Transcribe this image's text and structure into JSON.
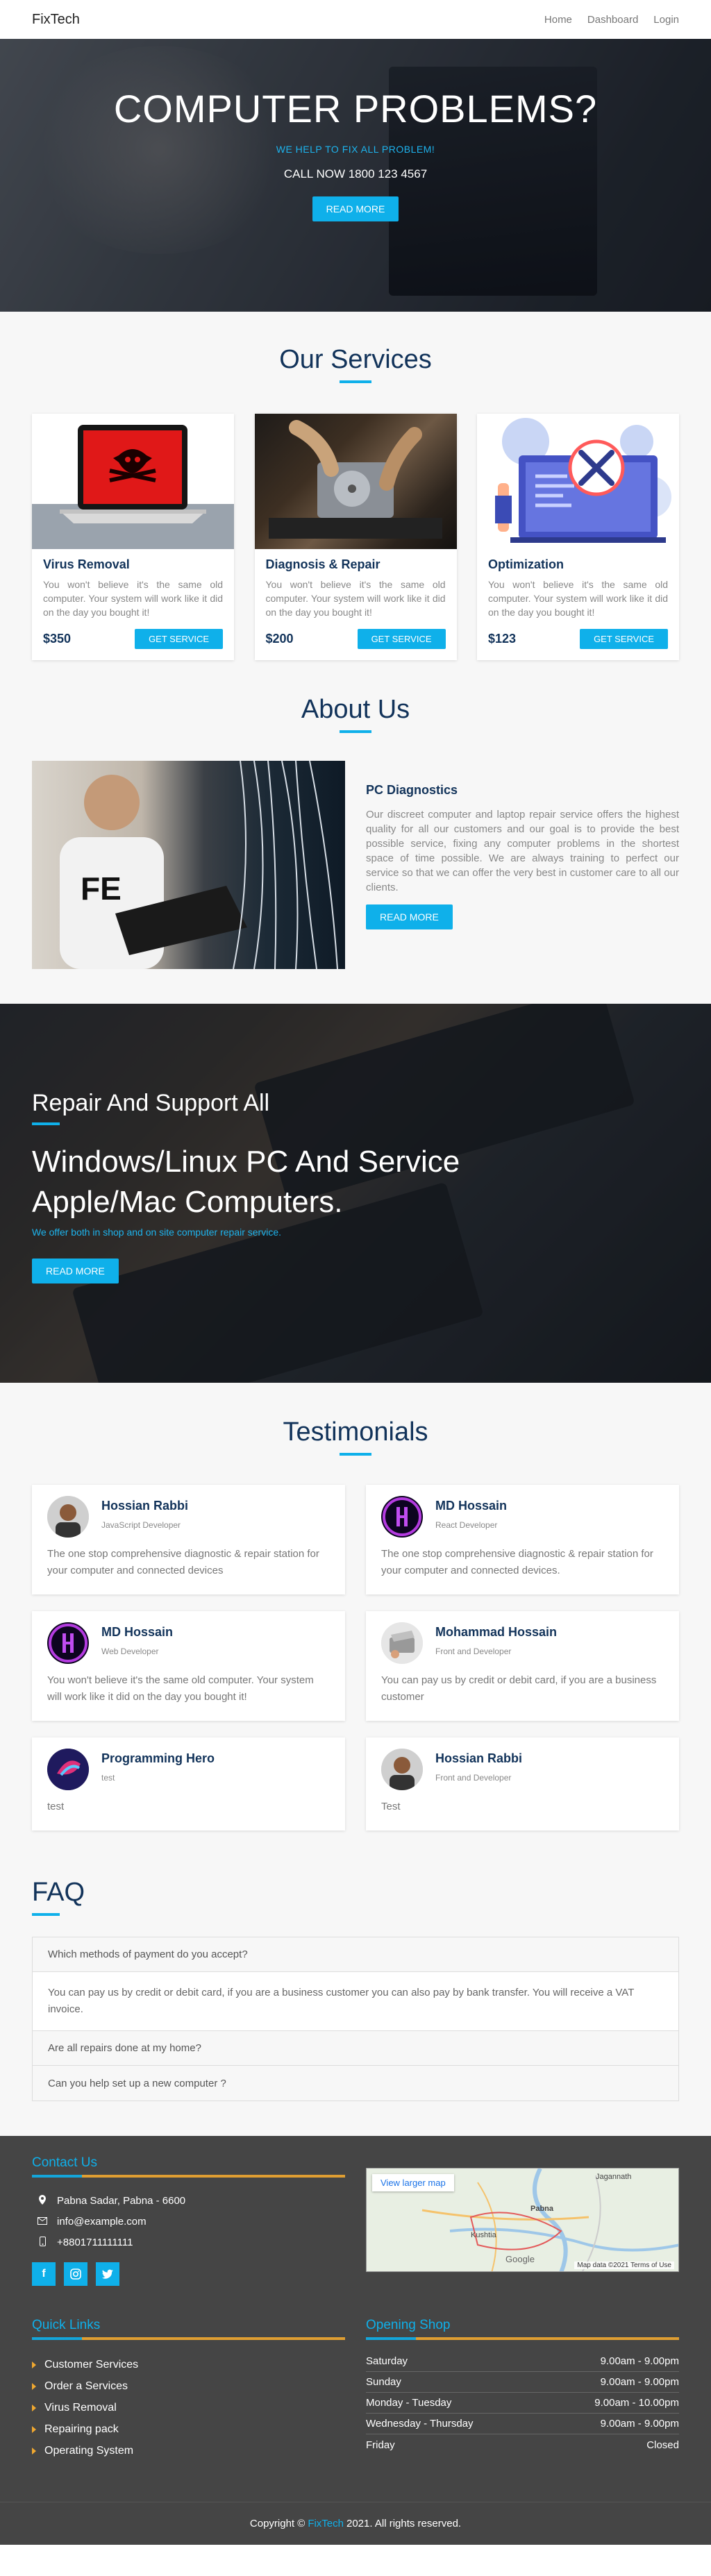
{
  "nav": {
    "brand": "FixTech",
    "links": [
      "Home",
      "Dashboard",
      "Login"
    ]
  },
  "hero": {
    "title": "COMPUTER PROBLEMS?",
    "subtitle": "WE HELP TO FIX ALL PROBLEM!",
    "phone": "CALL NOW 1800 123 4567",
    "button": "READ MORE"
  },
  "services": {
    "title": "Our Services",
    "items": [
      {
        "name": "Virus Removal",
        "description": "You won't believe it's the same old computer. Your system will work like it did on the day you bought it!",
        "price": "$350",
        "button": "GET SERVICE"
      },
      {
        "name": "Diagnosis & Repair",
        "description": "You won't believe it's the same old computer. Your system will work like it did on the day you bought it!",
        "price": "$200",
        "button": "GET SERVICE"
      },
      {
        "name": "Optimization",
        "description": "You won't believe it's the same old computer. Your system will work like it did on the day you bought it!",
        "price": "$123",
        "button": "GET SERVICE"
      }
    ]
  },
  "about": {
    "title": "About Us",
    "heading": "PC Diagnostics",
    "text": "Our discreet computer and laptop repair service offers the highest quality for all our customers and our goal is to provide the best possible service, fixing any computer problems in the shortest space of time possible. We are always training to perfect our service so that we can offer the very best in customer care to all our clients.",
    "button": "READ MORE"
  },
  "banner": {
    "line1": "Repair And Support All",
    "line2": "Windows/Linux PC And Service Apple/Mac Computers.",
    "line3": "We offer both in shop and on site computer repair service.",
    "button": "READ MORE"
  },
  "testimonials": {
    "title": "Testimonials",
    "items": [
      {
        "name": "Hossian Rabbi",
        "role": "JavaScript Developer",
        "text": "The one stop comprehensive diagnostic & repair station for your computer and connected devices"
      },
      {
        "name": "MD Hossain",
        "role": "React Developer",
        "text": "The one stop comprehensive diagnostic & repair station for your computer and connected devices."
      },
      {
        "name": "MD Hossain",
        "role": "Web Developer",
        "text": "You won't believe it's the same old computer. Your system will work like it did on the day you bought it!"
      },
      {
        "name": "Mohammad Hossain",
        "role": "Front and Developer",
        "text": "You can pay us by credit or debit card, if you are a business customer"
      },
      {
        "name": "Programming Hero",
        "role": "test",
        "text": "test"
      },
      {
        "name": "Hossian Rabbi",
        "role": "Front and Developer",
        "text": "Test"
      }
    ]
  },
  "faq": {
    "title": "FAQ",
    "q1": "Which methods of payment do you accept?",
    "a1": "You can pay us by credit or debit card, if you are a business customer you can also pay by bank transfer. You will receive a VAT invoice.",
    "q2": "Are all repairs done at my home?",
    "q3": "Can you help set up a new computer ?"
  },
  "footer": {
    "contact_title": "Contact Us",
    "address": "Pabna Sadar, Pabna - 6600",
    "email": "info@example.com",
    "phone": "+8801711111111",
    "map_button": "View larger map",
    "map_credit": "Map data ©2021   Terms of Use",
    "map_google": "Google",
    "map_city_1": "Pabna",
    "map_city_2": "Kushtia",
    "map_city_3": "Jagannath",
    "links_title": "Quick Links",
    "links": [
      "Customer Services",
      "Order a Services",
      "Virus Removal",
      "Repairing pack",
      "Operating System"
    ],
    "hours_title": "Opening Shop",
    "hours": [
      {
        "day": "Saturday",
        "time": "9.00am - 9.00pm"
      },
      {
        "day": "Sunday",
        "time": "9.00am - 9.00pm"
      },
      {
        "day": "Monday - Tuesday",
        "time": "9.00am - 10.00pm"
      },
      {
        "day": "Wednesday - Thursday",
        "time": "9.00am - 9.00pm"
      },
      {
        "day": "Friday",
        "time": "Closed"
      }
    ],
    "copyright_pre": "Copyright ©",
    "copyright_brand": "FixTech",
    "copyright_post": "2021. All rights reserved."
  }
}
